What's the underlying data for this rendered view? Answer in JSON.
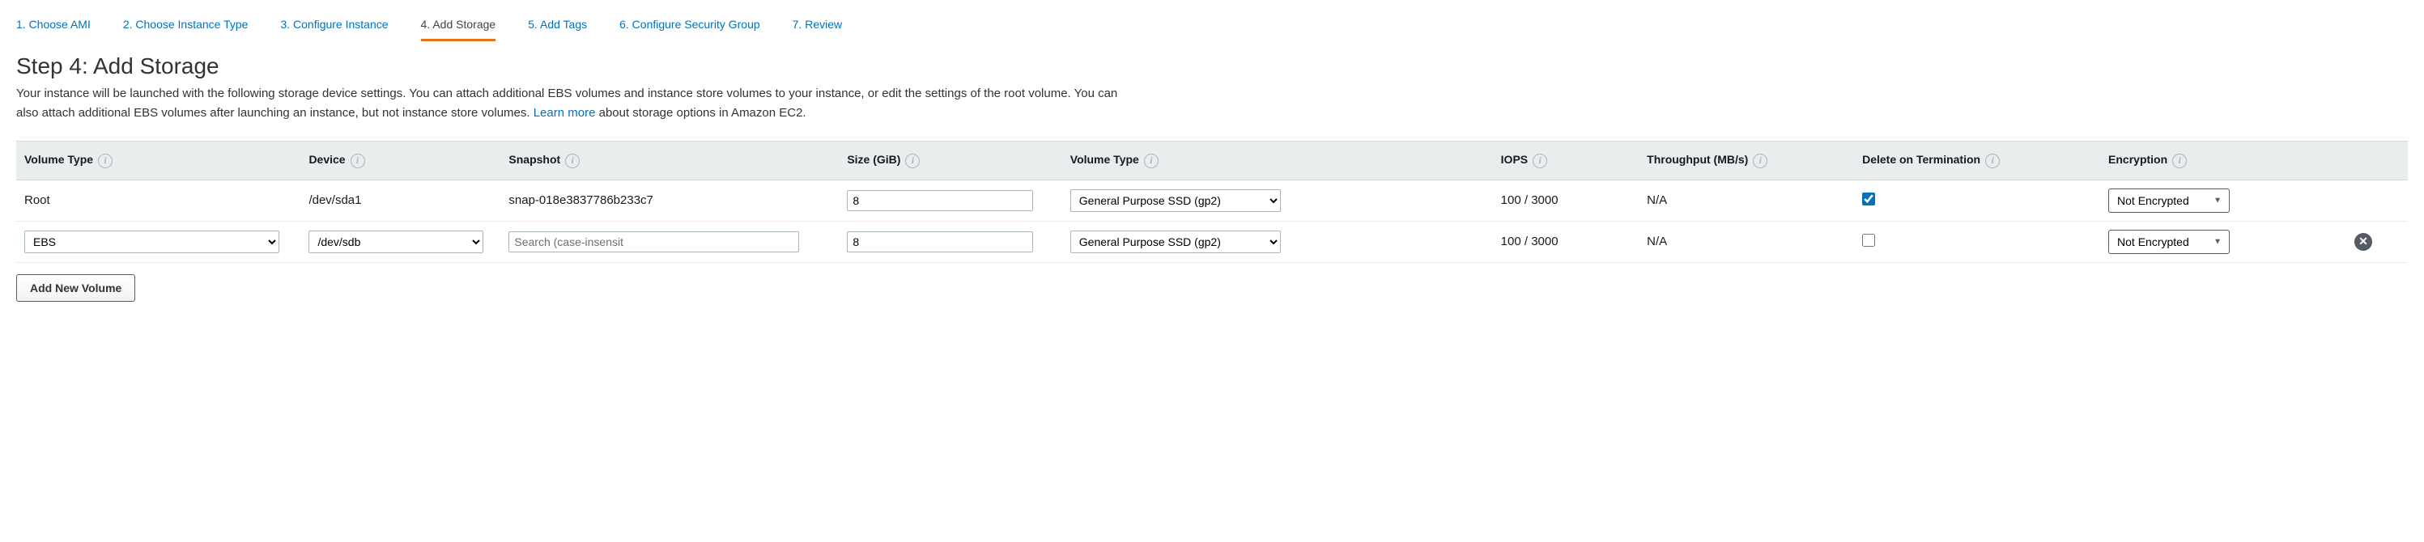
{
  "tabs": [
    {
      "label": "1. Choose AMI"
    },
    {
      "label": "2. Choose Instance Type"
    },
    {
      "label": "3. Configure Instance"
    },
    {
      "label": "4. Add Storage"
    },
    {
      "label": "5. Add Tags"
    },
    {
      "label": "6. Configure Security Group"
    },
    {
      "label": "7. Review"
    }
  ],
  "title": "Step 4: Add Storage",
  "desc_part1": "Your instance will be launched with the following storage device settings. You can attach additional EBS volumes and instance store volumes to your instance, or edit the settings of the root volume. You can also attach additional EBS volumes after launching an instance, but not instance store volumes. ",
  "desc_link": "Learn more",
  "desc_part2": " about storage options in Amazon EC2.",
  "headers": {
    "volume_type": "Volume Type",
    "device": "Device",
    "snapshot": "Snapshot",
    "size": "Size (GiB)",
    "volume_type2": "Volume Type",
    "iops": "IOPS",
    "throughput": "Throughput (MB/s)",
    "delete_on_term": "Delete on Termination",
    "encryption": "Encryption"
  },
  "rows": [
    {
      "volume_type": "Root",
      "device": "/dev/sda1",
      "snapshot": "snap-018e3837786b233c7",
      "size": "8",
      "volume_type_sel": "General Purpose SSD (gp2)",
      "iops": "100 / 3000",
      "throughput": "N/A",
      "delete_on_term": true,
      "encryption": "Not Encrypted"
    },
    {
      "volume_type": "EBS",
      "device": "/dev/sdb",
      "snapshot_placeholder": "Search (case-insensit",
      "size": "8",
      "volume_type_sel": "General Purpose SSD (gp2)",
      "iops": "100 / 3000",
      "throughput": "N/A",
      "delete_on_term": false,
      "encryption": "Not Encrypted"
    }
  ],
  "add_btn": "Add New Volume",
  "info_glyph": "i"
}
